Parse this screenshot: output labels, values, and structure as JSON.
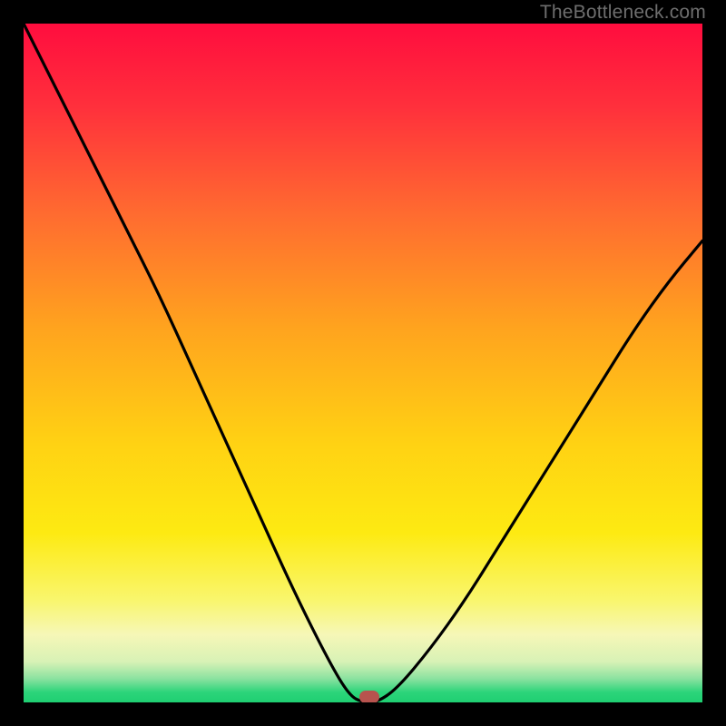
{
  "watermark": "TheBottleneck.com",
  "chart_data": {
    "type": "line",
    "title": "",
    "xlabel": "",
    "ylabel": "",
    "xlim": [
      0,
      100
    ],
    "ylim": [
      0,
      100
    ],
    "grid": false,
    "legend": false,
    "curve": {
      "x": [
        0,
        5,
        10,
        15,
        20,
        25,
        30,
        35,
        40,
        45,
        48,
        50,
        52,
        55,
        60,
        65,
        70,
        75,
        80,
        85,
        90,
        95,
        100
      ],
      "y": [
        100,
        90,
        80,
        70,
        60,
        49,
        38,
        27,
        16,
        6,
        1,
        0,
        0,
        2,
        8,
        15,
        23,
        31,
        39,
        47,
        55,
        62,
        68
      ]
    },
    "min_point": {
      "x": 51,
      "y": 0.5
    },
    "background_gradient": {
      "stops": [
        {
          "pos": 0.0,
          "color": "#ff0d3e"
        },
        {
          "pos": 0.12,
          "color": "#ff2f3c"
        },
        {
          "pos": 0.28,
          "color": "#ff6b30"
        },
        {
          "pos": 0.45,
          "color": "#ffa41e"
        },
        {
          "pos": 0.62,
          "color": "#ffd213"
        },
        {
          "pos": 0.75,
          "color": "#fdea12"
        },
        {
          "pos": 0.85,
          "color": "#f9f66e"
        },
        {
          "pos": 0.9,
          "color": "#f6f7b7"
        },
        {
          "pos": 0.94,
          "color": "#d8f2b6"
        },
        {
          "pos": 0.965,
          "color": "#8be2a0"
        },
        {
          "pos": 0.985,
          "color": "#2cd47a"
        },
        {
          "pos": 1.0,
          "color": "#1fcf72"
        }
      ]
    }
  }
}
